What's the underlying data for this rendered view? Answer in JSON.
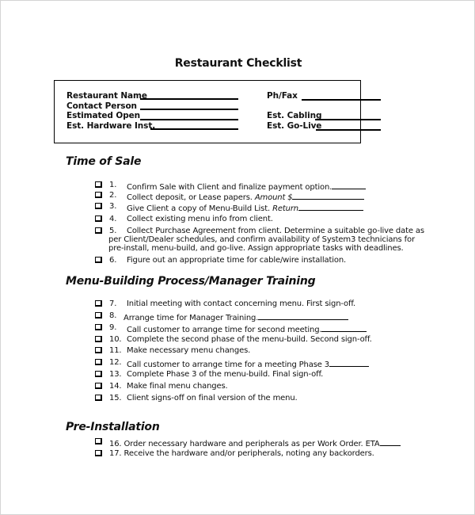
{
  "document": {
    "title": "Restaurant Checklist",
    "info_fields": [
      {
        "label": "Restaurant Name"
      },
      {
        "label": "Contact Person"
      },
      {
        "label": "Estimated Open"
      },
      {
        "label": "Est. Hardware Inst."
      },
      {
        "label": "Ph/Fax"
      },
      {
        "label": "Est. Cabling"
      },
      {
        "label": "Est. Go-Live"
      }
    ],
    "sections": [
      {
        "title": "Time of Sale",
        "items": [
          {
            "num": "1.",
            "text": "Confirm Sale with Client and finalize payment option.",
            "checked": false
          },
          {
            "num": "2.",
            "text": "Collect deposit, or Lease papers. ",
            "italic": "Amount $",
            "checked": false
          },
          {
            "num": "3.",
            "text": "Give Client a copy of Menu-Build List. ",
            "italic": "Return",
            "checked": false
          },
          {
            "num": "4.",
            "text": "Collect existing menu info from client.",
            "checked": false
          },
          {
            "num": "5.",
            "text": "Collect Purchase Agreement from client. Determine a suitable go-live date as",
            "line2": "per Client/Dealer schedules, and confirm availability of System3 technicians for",
            "line3": "pre-install, menu-build, and go-live. Assign appropriate tasks with deadlines.",
            "checked": false
          },
          {
            "num": "6.",
            "text": "Figure out an appropriate time for cable/wire installation.",
            "checked": false
          }
        ]
      },
      {
        "title": "Menu-Building Process/Manager Training",
        "items": [
          {
            "num": "7.",
            "text": "Initial meeting with contact concerning menu. First sign-off.",
            "checked": false
          },
          {
            "num": "8.",
            "text": "Arrange time for Manager Training.",
            "checked": false
          },
          {
            "num": "9.",
            "text": "Call customer to arrange time for second meeting.",
            "checked": false
          },
          {
            "num": "10.",
            "text": "Complete the second phase of the menu-build. Second sign-off.",
            "checked": false
          },
          {
            "num": "11.",
            "text": "Make necessary menu changes.",
            "checked": false
          },
          {
            "num": "12.",
            "text": "Call customer to arrange time for a meeting Phase 3",
            "checked": false
          },
          {
            "num": "13.",
            "text": "Complete Phase 3 of the menu-build. Final sign-off.",
            "checked": false
          },
          {
            "num": "14.",
            "text": "Make final menu changes.",
            "checked": false
          },
          {
            "num": "15.",
            "text": "Client signs-off on final version of the menu.",
            "checked": false
          }
        ]
      },
      {
        "title": "Pre-Installation",
        "items": [
          {
            "num": "16.",
            "text": "Order necessary hardware and peripherals as per Work Order. ETA",
            "checked": false
          },
          {
            "num": "17.",
            "text": "Receive the hardware and/or peripherals, noting any backorders.",
            "checked": false
          }
        ]
      }
    ]
  }
}
